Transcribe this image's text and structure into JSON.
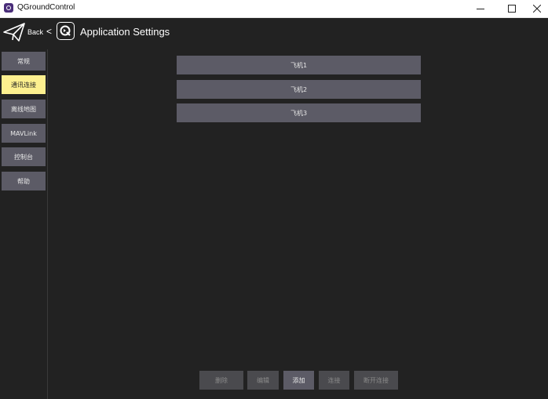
{
  "window": {
    "title": "QGroundControl"
  },
  "header": {
    "back_label": "Back",
    "chevron": "<",
    "title": "Application Settings"
  },
  "sidebar": {
    "items": [
      {
        "label": "常规",
        "active": false
      },
      {
        "label": "通讯连接",
        "active": true
      },
      {
        "label": "离线地图",
        "active": false
      },
      {
        "label": "MAVLink",
        "active": false
      },
      {
        "label": "控制台",
        "active": false
      },
      {
        "label": "帮助",
        "active": false
      }
    ]
  },
  "links": [
    {
      "label": "飞机1"
    },
    {
      "label": "飞机2"
    },
    {
      "label": "飞机3"
    }
  ],
  "actions": [
    {
      "label": "删除",
      "enabled": false
    },
    {
      "label": "编辑",
      "enabled": false
    },
    {
      "label": "添加",
      "enabled": true
    },
    {
      "label": "连接",
      "enabled": false
    },
    {
      "label": "断开连接",
      "enabled": false
    }
  ],
  "colors": {
    "background": "#222222",
    "button": "#5c5b66",
    "active_highlight": "#fdf08f",
    "disabled_button": "#4a4a4e"
  }
}
